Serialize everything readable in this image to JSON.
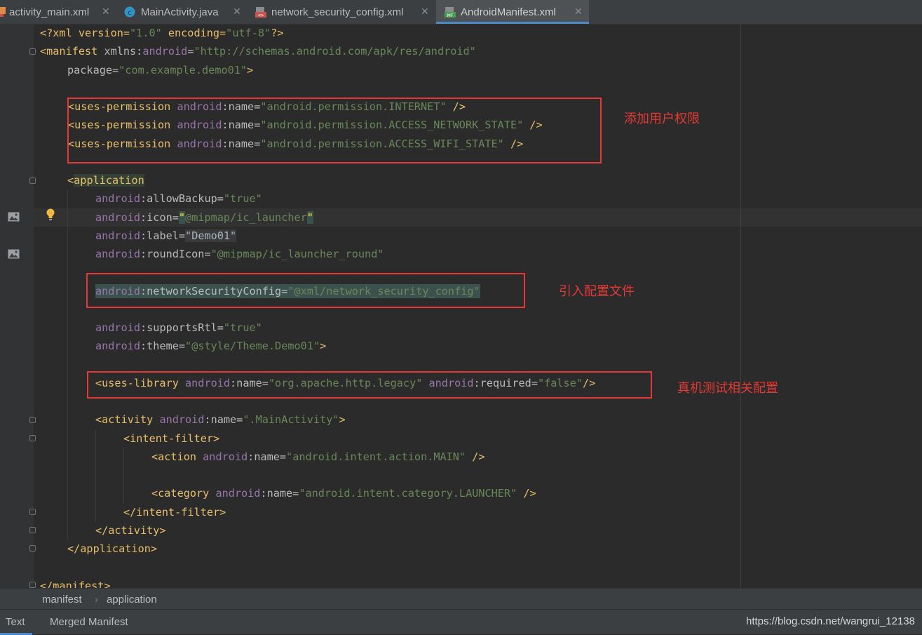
{
  "tabs": [
    {
      "label": "activity_main.xml",
      "icon": "xml-layout-icon"
    },
    {
      "label": "MainActivity.java",
      "icon": "java-class-icon"
    },
    {
      "label": "network_security_config.xml",
      "icon": "xml-file-icon"
    },
    {
      "label": "AndroidManifest.xml",
      "icon": "manifest-file-icon",
      "active": true
    }
  ],
  "code": {
    "l1": {
      "t1": "<?xml version=",
      "v1": "\"1.0\"",
      "t2": " encoding=",
      "v2": "\"utf-8\"",
      "t3": "?>"
    },
    "l2": {
      "tag": "<manifest ",
      "a1": "xmlns:",
      "ns": "android",
      "eq": "=",
      "val": "\"http://schemas.android.com/apk/res/android\""
    },
    "l3": {
      "attr": "package",
      "eq": "=",
      "val": "\"com.example.demo01\"",
      "end": ">"
    },
    "perm": [
      {
        "tag": "<uses-permission ",
        "ns": "android",
        "colon": ":",
        "attr": "name",
        "eq": "=",
        "val": "\"android.permission.INTERNET\"",
        "end": " />"
      },
      {
        "tag": "<uses-permission ",
        "ns": "android",
        "colon": ":",
        "attr": "name",
        "eq": "=",
        "val": "\"android.permission.ACCESS_NETWORK_STATE\"",
        "end": " />"
      },
      {
        "tag": "<uses-permission ",
        "ns": "android",
        "colon": ":",
        "attr": "name",
        "eq": "=",
        "val": "\"android.permission.ACCESS_WIFI_STATE\"",
        "end": " />"
      }
    ],
    "app_open": {
      "lt": "<",
      "tag": "application"
    },
    "app_attrs": [
      {
        "ns": "android",
        "attr": ":allowBackup",
        "eq": "=",
        "val": "\"true\""
      },
      {
        "ns": "android",
        "attr": ":icon",
        "eq": "=",
        "q1": "\"",
        "val": "@mipmap/ic_launcher",
        "q2": "\""
      },
      {
        "ns": "android",
        "attr": ":label",
        "eq": "=",
        "val": "\"Demo01\""
      },
      {
        "ns": "android",
        "attr": ":roundIcon",
        "eq": "=",
        "val": "\"@mipmap/ic_launcher_round\""
      }
    ],
    "nsc": {
      "ns": "android",
      "attr": ":networkSecurityConfig",
      "eq": "=",
      "val": "\"@xml/network_security_config\""
    },
    "app_attrs2": [
      {
        "ns": "android",
        "attr": ":supportsRtl",
        "eq": "=",
        "val": "\"true\""
      },
      {
        "ns": "android",
        "attr": ":theme",
        "eq": "=",
        "val": "\"@style/Theme.Demo01\"",
        "end": ">"
      }
    ],
    "lib": {
      "tag": "<uses-library ",
      "ns1": "android",
      "a1": ":name",
      "eq1": "=",
      "v1": "\"org.apache.http.legacy\"",
      "sp": " ",
      "ns2": "android",
      "a2": ":required",
      "eq2": "=",
      "v2": "\"false\"",
      "end": "/>"
    },
    "activity": {
      "tag": "<activity ",
      "ns": "android",
      "attr": ":name",
      "eq": "=",
      "val": "\".MainActivity\"",
      "end": ">"
    },
    "if_open": "<intent-filter>",
    "action": {
      "tag": "<action ",
      "ns": "android",
      "attr": ":name",
      "eq": "=",
      "val": "\"android.intent.action.MAIN\"",
      "end": " />"
    },
    "category": {
      "tag": "<category ",
      "ns": "android",
      "attr": ":name",
      "eq": "=",
      "val": "\"android.intent.category.LAUNCHER\"",
      "end": " />"
    },
    "if_close": "</intent-filter>",
    "act_close": "</activity>",
    "app_close": "</application>",
    "man_close": "</manifest>"
  },
  "annotations": {
    "permissions": "添加用户权限",
    "config": "引入配置文件",
    "library": "真机测试相关配置"
  },
  "breadcrumb": [
    "manifest",
    "application"
  ],
  "breadcrumb_sep": "›",
  "bottom_tabs": [
    {
      "label": "Text",
      "active": true
    },
    {
      "label": "Merged Manifest"
    }
  ],
  "watermark": "https://blog.csdn.net/wangrui_12138",
  "colors": {
    "background": "#2b2b2b",
    "tag": "#e8bf6a",
    "namespace": "#9876aa",
    "value": "#6a8759",
    "annotation_red": "#e53935",
    "active_tab_accent": "#4a88c7"
  }
}
